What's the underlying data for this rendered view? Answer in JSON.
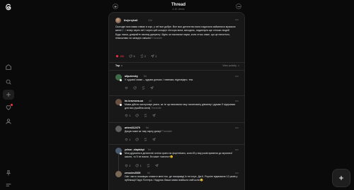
{
  "header": {
    "title": "Thread",
    "subtitle": "4.1K views"
  },
  "main_post": {
    "username": "thejerryhall",
    "time": "10d",
    "paragraphs": [
      "Сьогодні моя мама співає в хорі, у неї все добре. Все моє дитинство вона надихала займатися музикою мене🎼 і тепер через неї і через цей концерт з'ючора вона, виходить, надихнула ще стільки людей",
      "Будь ласка, довіряйте своєму джерелу і йдіть за покликом науки, коли хтось каже, що це нелогічно, неможливо чи занадто смішно!"
    ],
    "translate": "Translate",
    "likes": "398",
    "comments": "5",
    "reposts": "2",
    "shares": "2"
  },
  "sort": {
    "label": "Top",
    "view_activity": "View activity"
  },
  "replies": [
    {
      "username": "allputersky",
      "time": "8d",
      "text": "У чудової мами – чудова донька. І навпаки, відповідно, теж",
      "translate": "",
      "likes": "",
      "comments": "",
      "color": "#3f6a4a"
    },
    {
      "username": "lm.kravnova.ua",
      "time": "4d",
      "text": "Мама дійсно заслуговує уваги, за те що виховала таку талановиту дівчинку і думаю її підтримка для вас рушійна сила)",
      "translate": "Translate",
      "likes": "1",
      "comments": "",
      "color": "#6b5044"
    },
    {
      "username": "artem312479",
      "time": "8d",
      "text": "Дякую мамі за таку гарну дочку!",
      "translate": "Translate",
      "likes": "1",
      "comments": "",
      "color": "#5d5d5d"
    },
    {
      "username": "yelsor_slaptskyi",
      "time": "5d",
      "text": "Моя дружина в дитинстві хотіла грати на фортепіано, коли їй у віці років привели до музичної школи, то її не взяли, бо каже «затоно»😉",
      "translate": "",
      "likes": "2",
      "comments": "1",
      "color": "#4a5a6e"
    },
    {
      "username": "zeroclev2005",
      "time": "5d",
      "text": "Світ часто посміщає ставити мені тих, де насправді їх не існує. Дж.К. Роулінг відмовили 12 разів у публікації Гаррі Поттера. Надрось Ваша мама знайшла свій шлях😊",
      "translate": "",
      "likes": "",
      "comments": "",
      "color": "#7a6a55"
    }
  ]
}
